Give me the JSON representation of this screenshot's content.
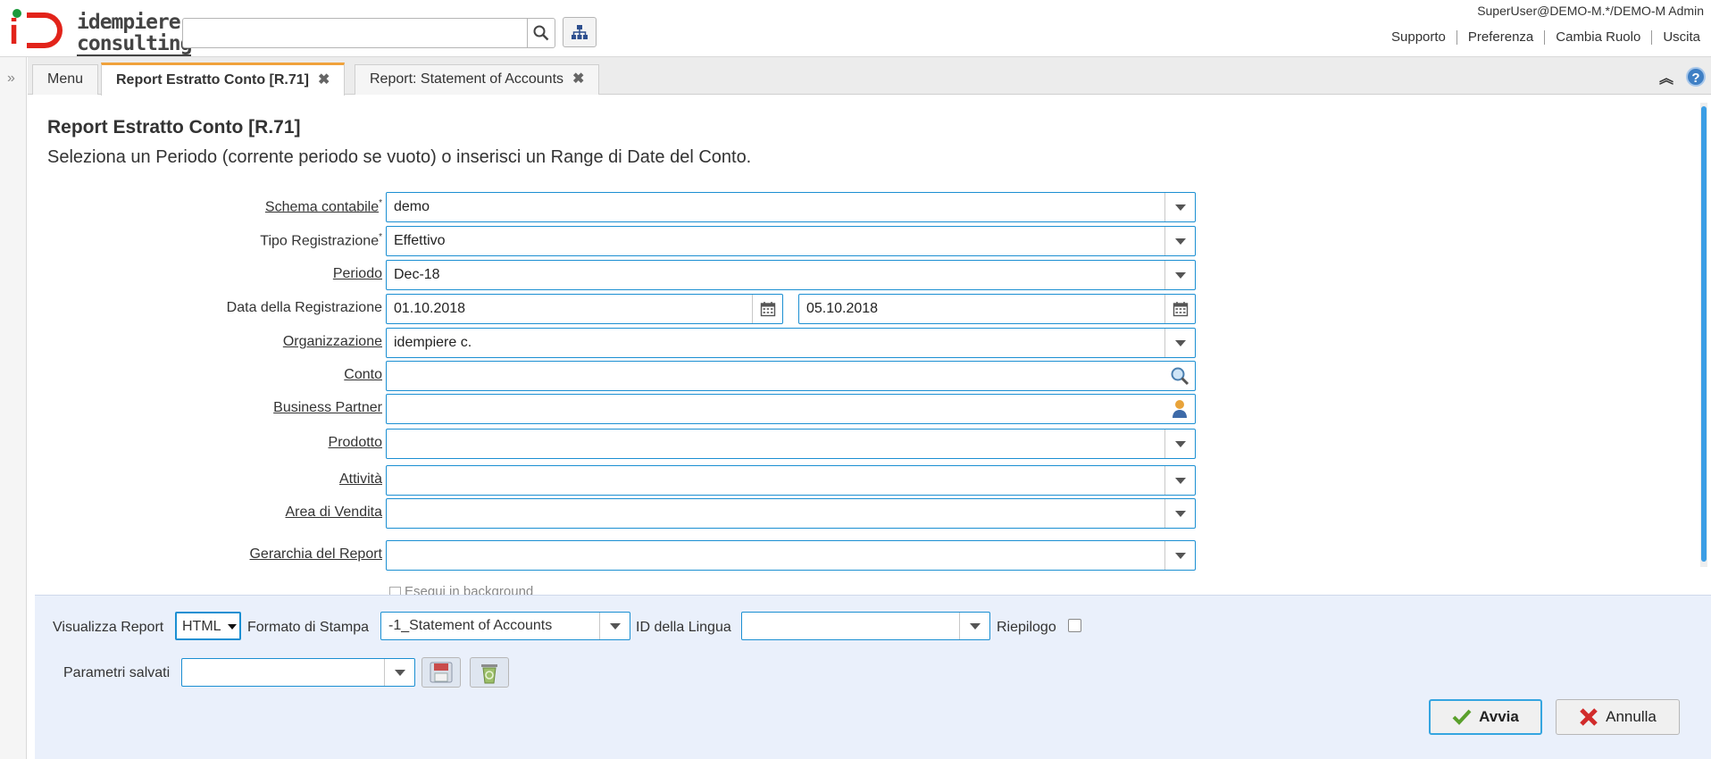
{
  "header": {
    "logo_line1": "idempiere",
    "logo_line2": "consulting",
    "search_placeholder": "",
    "user": "SuperUser@DEMO-M.*/DEMO-M Admin",
    "links": [
      "Supporto",
      "Preferenza",
      "Cambia Ruolo",
      "Uscita"
    ]
  },
  "tabs": [
    {
      "label": "Menu"
    },
    {
      "label": "Report Estratto Conto [R.71]"
    },
    {
      "label": "Report: Statement of Accounts"
    }
  ],
  "process": {
    "title": "Report Estratto Conto [R.71]",
    "description": "Seleziona un Periodo (corrente periodo se vuoto) o inserisci un Range di Date del Conto."
  },
  "fields": {
    "schema": {
      "label": "Schema contabile",
      "req": "*",
      "value": "demo"
    },
    "tipo": {
      "label": "Tipo Registrazione",
      "req": "*",
      "value": "Effettivo"
    },
    "periodo": {
      "label": "Periodo",
      "value": "Dec-18"
    },
    "data": {
      "label": "Data della Registrazione",
      "from": "01.10.2018",
      "to": "05.10.2018"
    },
    "org": {
      "label": "Organizzazione",
      "value": "idempiere c."
    },
    "conto": {
      "label": "Conto",
      "value": ""
    },
    "bp": {
      "label": "Business Partner",
      "value": ""
    },
    "prodotto": {
      "label": "Prodotto",
      "value": ""
    },
    "attivita": {
      "label": "Attività",
      "value": ""
    },
    "area": {
      "label": "Area di Vendita",
      "value": ""
    },
    "gerarchia": {
      "label": "Gerarchia del Report",
      "value": ""
    },
    "background": {
      "label": "Esegui in background"
    }
  },
  "bottom": {
    "visualizza_label": "Visualizza Report",
    "visualizza_value": "HTML",
    "formato_label": "Formato di Stampa",
    "formato_value": "-1_Statement of Accounts",
    "lingua_label": "ID della Lingua",
    "lingua_value": "",
    "riepilogo_label": "Riepilogo",
    "parametri_label": "Parametri salvati",
    "parametri_value": "",
    "ok_label": "Avvia",
    "cancel_label": "Annulla"
  },
  "colors": {
    "accent": "#1b8fd2",
    "tab_active": "#f0a23c",
    "bottom_bg": "#eaf0fb"
  }
}
